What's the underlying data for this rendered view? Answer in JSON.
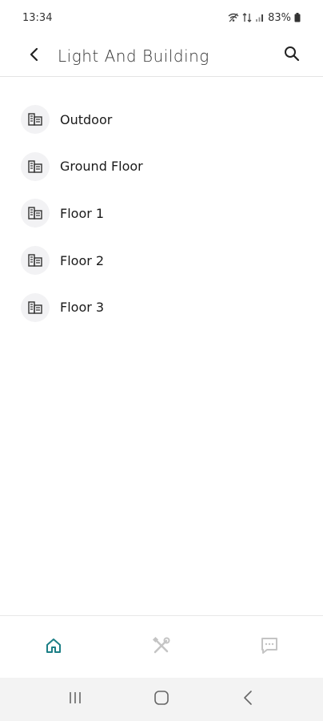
{
  "status_bar": {
    "time": "13:34",
    "battery": "83%",
    "icons": [
      "wifi-off-icon",
      "data-icon",
      "signal-icon",
      "battery-icon"
    ]
  },
  "app_bar": {
    "title": "Light And Building",
    "back_icon": "chevron-left-icon",
    "search_icon": "search-icon"
  },
  "list": {
    "items": [
      {
        "label": "Outdoor",
        "icon": "building-icon"
      },
      {
        "label": "Ground Floor",
        "icon": "building-icon"
      },
      {
        "label": "Floor 1",
        "icon": "building-icon"
      },
      {
        "label": "Floor 2",
        "icon": "building-icon"
      },
      {
        "label": "Floor 3",
        "icon": "building-icon"
      }
    ]
  },
  "bottom_nav": {
    "items": [
      {
        "icon": "home-icon",
        "active": true
      },
      {
        "icon": "tools-icon",
        "active": false
      },
      {
        "icon": "chat-icon",
        "active": false
      }
    ]
  },
  "colors": {
    "accent": "#1c7f86",
    "inactive": "#c4c4c4"
  }
}
